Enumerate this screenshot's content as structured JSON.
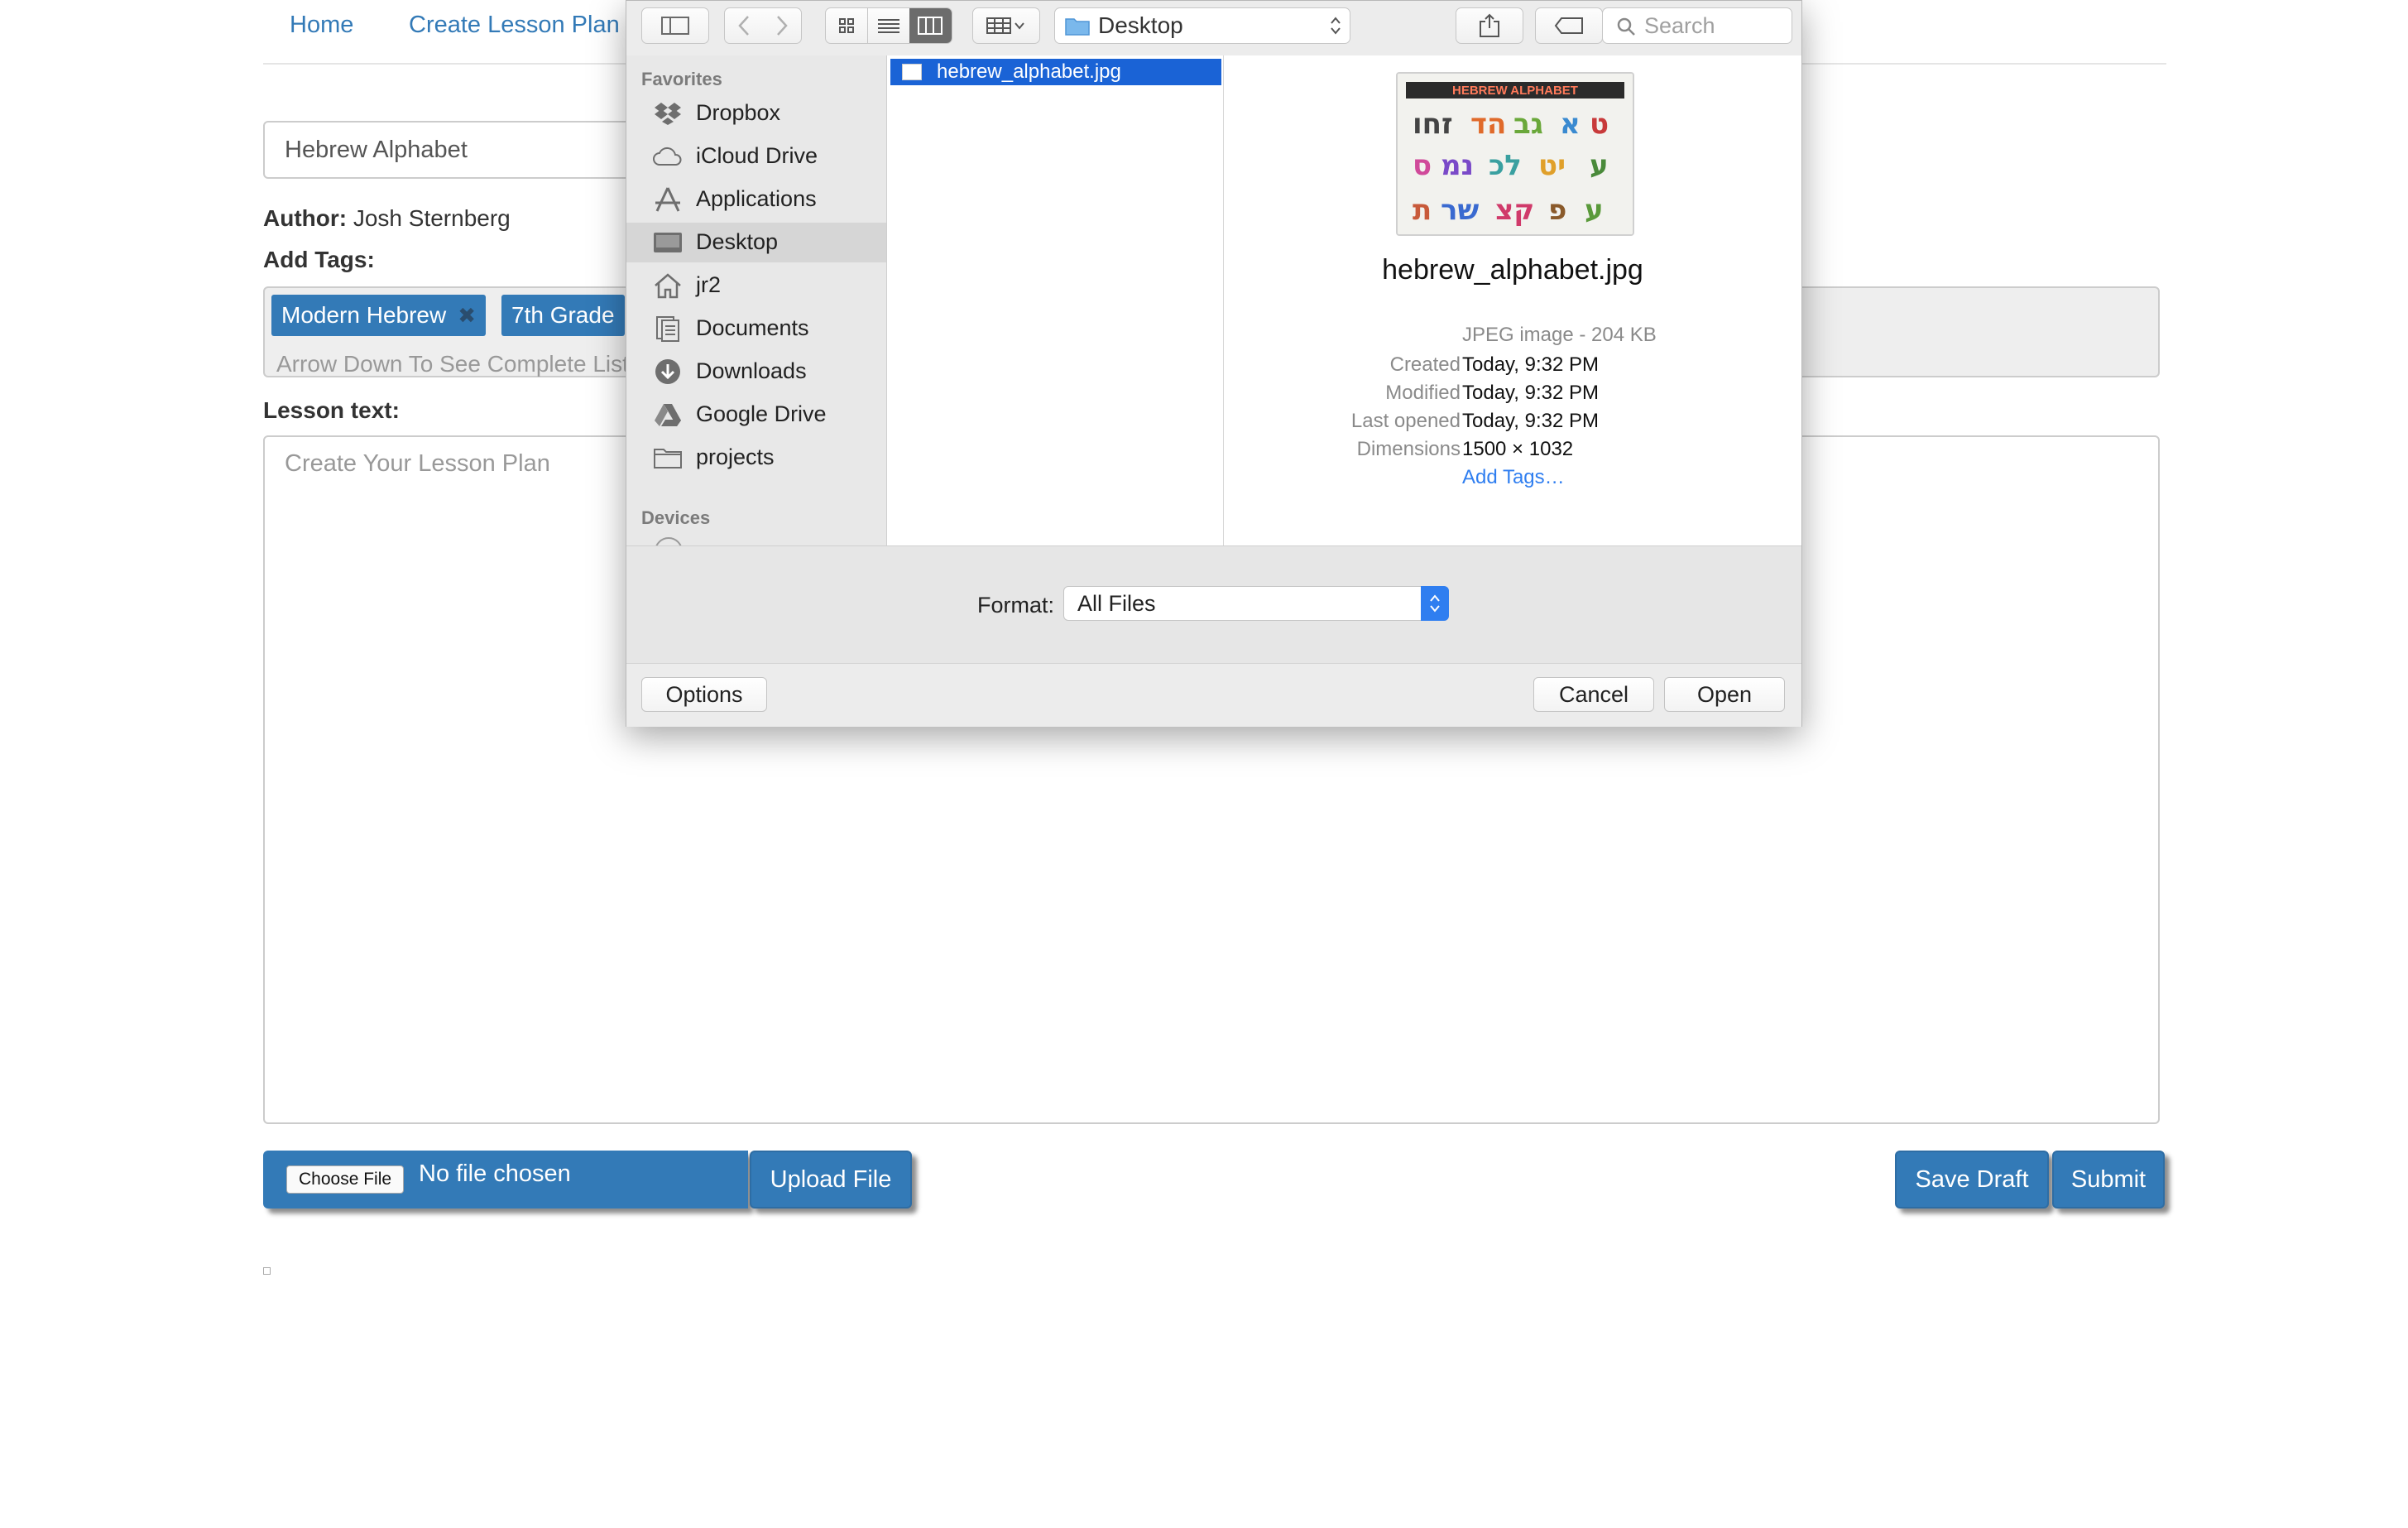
{
  "page": {
    "nav": [
      "Home",
      "Create Lesson Plan"
    ],
    "title_value": "Hebrew Alphabet",
    "author_label": "Author:",
    "author_name": "Josh Sternberg",
    "tags_label": "Add Tags:",
    "tags": [
      "Modern Hebrew",
      "7th Grade"
    ],
    "tag_remove_glyph": "✖",
    "tag_placeholder": "Arrow Down To See Complete List",
    "lesson_label": "Lesson text:",
    "lesson_placeholder": "Create Your Lesson Plan",
    "choose_file": "Choose File",
    "no_file": "No file chosen",
    "upload_button": "Upload File",
    "save_draft_button": "Save Draft",
    "submit_button": "Submit",
    "accent_color": "#337ab7"
  },
  "dialog": {
    "location": "Desktop",
    "search_placeholder": "Search",
    "sidebar": {
      "favorites_header": "Favorites",
      "devices_header": "Devices",
      "items": [
        {
          "label": "Dropbox",
          "icon": "dropbox-icon"
        },
        {
          "label": "iCloud Drive",
          "icon": "cloud-icon"
        },
        {
          "label": "Applications",
          "icon": "applications-icon"
        },
        {
          "label": "Desktop",
          "icon": "desktop-icon",
          "selected": true
        },
        {
          "label": "jr2",
          "icon": "home-icon"
        },
        {
          "label": "Documents",
          "icon": "documents-icon"
        },
        {
          "label": "Downloads",
          "icon": "downloads-icon"
        },
        {
          "label": "Google Drive",
          "icon": "google-drive-icon"
        },
        {
          "label": "projects",
          "icon": "folder-icon"
        }
      ]
    },
    "files": [
      "hebrew_alphabet.jpg"
    ],
    "preview": {
      "thumbnail_title": "HEBREW ALPHABET",
      "name": "hebrew_alphabet.jpg",
      "kind": "JPEG image - 204 KB",
      "created_label": "Created",
      "created": "Today, 9:32 PM",
      "modified_label": "Modified",
      "modified": "Today, 9:32 PM",
      "last_opened_label": "Last opened",
      "last_opened": "Today, 9:32 PM",
      "dimensions_label": "Dimensions",
      "dimensions": "1500 × 1032",
      "add_tags": "Add Tags…"
    },
    "format_label": "Format:",
    "format_value": "All Files",
    "options_button": "Options",
    "cancel_button": "Cancel",
    "open_button": "Open",
    "selection_color": "#1a63d6"
  }
}
